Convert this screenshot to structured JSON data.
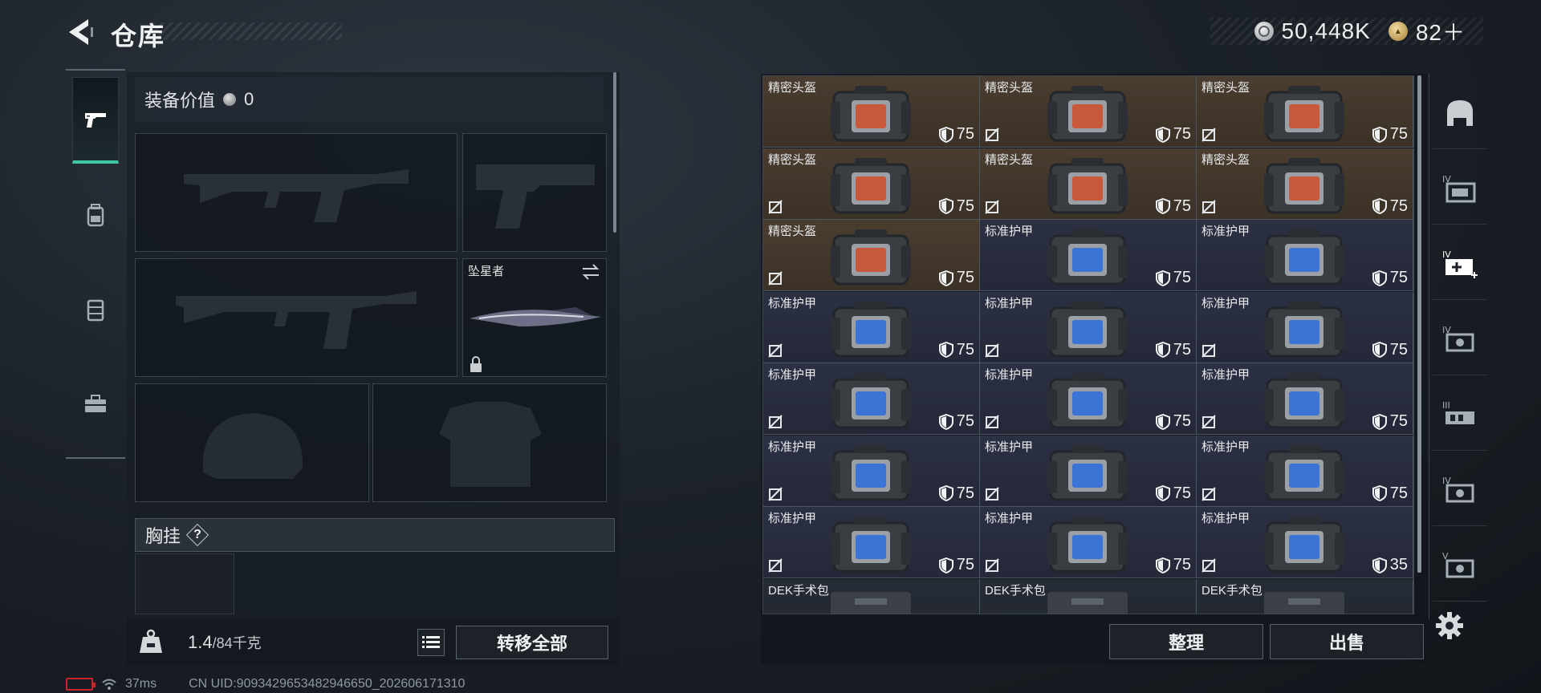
{
  "header": {
    "title": "仓库"
  },
  "currency": {
    "silver": "50,448K",
    "gold": "82＋"
  },
  "loadout": {
    "equip_value_label": "装备价值",
    "equip_value": "0",
    "melee_name": "坠星者",
    "chest_label": "胸挂",
    "help_symbol": "?",
    "weight_current": "1.4",
    "weight_max": "/84千克",
    "transfer_all_label": "转移全部"
  },
  "stash": {
    "items": [
      {
        "name": "精密头盔",
        "kind": "helmet",
        "durability": "75",
        "no_insure": false
      },
      {
        "name": "精密头盔",
        "kind": "helmet",
        "durability": "75",
        "no_insure": true
      },
      {
        "name": "精密头盔",
        "kind": "helmet",
        "durability": "75",
        "no_insure": true
      },
      {
        "name": "精密头盔",
        "kind": "helmet",
        "durability": "75",
        "no_insure": true
      },
      {
        "name": "精密头盔",
        "kind": "helmet",
        "durability": "75",
        "no_insure": true
      },
      {
        "name": "精密头盔",
        "kind": "helmet",
        "durability": "75",
        "no_insure": true
      },
      {
        "name": "精密头盔",
        "kind": "helmet",
        "durability": "75",
        "no_insure": true
      },
      {
        "name": "标准护甲",
        "kind": "armor",
        "durability": "75",
        "no_insure": false
      },
      {
        "name": "标准护甲",
        "kind": "armor",
        "durability": "75",
        "no_insure": false
      },
      {
        "name": "标准护甲",
        "kind": "armor",
        "durability": "75",
        "no_insure": true
      },
      {
        "name": "标准护甲",
        "kind": "armor",
        "durability": "75",
        "no_insure": true
      },
      {
        "name": "标准护甲",
        "kind": "armor",
        "durability": "75",
        "no_insure": true
      },
      {
        "name": "标准护甲",
        "kind": "armor",
        "durability": "75",
        "no_insure": true
      },
      {
        "name": "标准护甲",
        "kind": "armor",
        "durability": "75",
        "no_insure": true
      },
      {
        "name": "标准护甲",
        "kind": "armor",
        "durability": "75",
        "no_insure": true
      },
      {
        "name": "标准护甲",
        "kind": "armor",
        "durability": "75",
        "no_insure": true
      },
      {
        "name": "标准护甲",
        "kind": "armor",
        "durability": "75",
        "no_insure": true
      },
      {
        "name": "标准护甲",
        "kind": "armor",
        "durability": "75",
        "no_insure": true
      },
      {
        "name": "标准护甲",
        "kind": "armor",
        "durability": "75",
        "no_insure": true
      },
      {
        "name": "标准护甲",
        "kind": "armor",
        "durability": "75",
        "no_insure": true
      },
      {
        "name": "标准护甲",
        "kind": "armor",
        "durability": "35",
        "no_insure": true
      },
      {
        "name": "DEK手术包",
        "kind": "medkit",
        "durability": "",
        "no_insure": false
      },
      {
        "name": "DEK手术包",
        "kind": "medkit",
        "durability": "",
        "no_insure": false
      },
      {
        "name": "DEK手术包",
        "kind": "medkit",
        "durability": "",
        "no_insure": false
      }
    ],
    "sort_label": "整理",
    "sell_label": "出售"
  },
  "status": {
    "ping": "37ms",
    "uid": "CN UID:9093429653482946650_202606171310"
  },
  "colors": {
    "accent": "#3fc7a4",
    "helmet_bg": "#4a3d30",
    "armor_bg": "#2b3043",
    "battery_low": "#c8242c"
  },
  "icons": {
    "left_tabs": [
      "pistol-icon",
      "backpack-icon",
      "vest-icon",
      "toolbox-icon"
    ],
    "right_tabs": [
      "helmet-filter-icon",
      "iv-case-icon",
      "iv-medkit-icon",
      "iv-armor-icon",
      "iii-rig-icon",
      "iv-armor-2-icon",
      "v-armor-icon"
    ]
  }
}
